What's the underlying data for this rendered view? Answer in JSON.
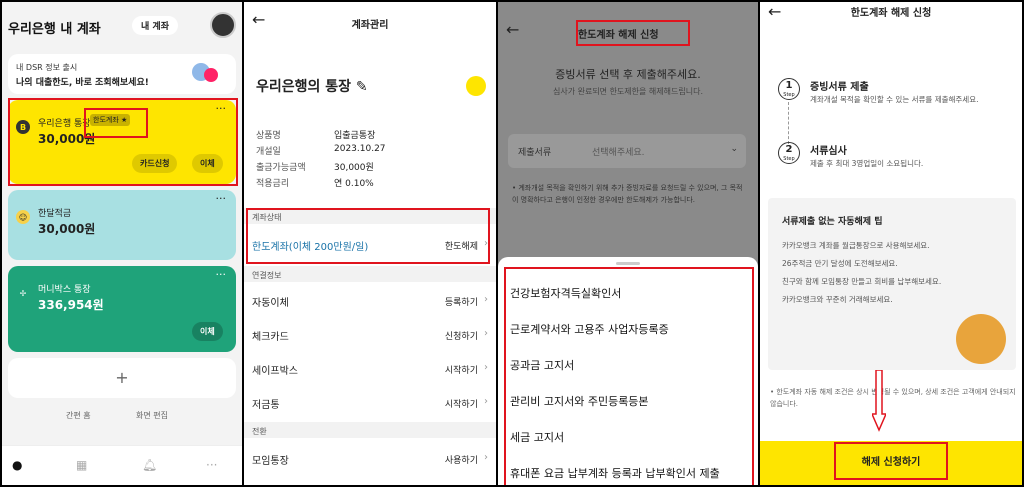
{
  "p1": {
    "title": "우리은행 내 계좌",
    "pill": "내 계좌",
    "banner_line1": "내 DSR 정보 출시",
    "banner_line2": "나의 대출한도, 바로 조회해보세요!",
    "card1": {
      "icon": "B",
      "name": "우리은행 통장",
      "badge": "한도계좌 ★",
      "amount": "30,000원",
      "btn1": "카드신청",
      "btn2": "이체"
    },
    "card2": {
      "name": "한달적금",
      "amount": "30,000원"
    },
    "card3": {
      "name": "머니박스 통장",
      "amount": "336,954원",
      "btn": "이체"
    },
    "plus": "+",
    "link1": "간편 홈",
    "link2": "화면 편집",
    "tabs": [
      "home-icon",
      "grid-icon",
      "bell-icon",
      "more-icon"
    ]
  },
  "p2": {
    "title": "계좌관리",
    "account_name": "우리은행의 통장 ✎",
    "rows": [
      {
        "k": "상품명",
        "v": "입출금통장"
      },
      {
        "k": "개설일",
        "v": "2023.10.27"
      },
      {
        "k": "출금가능금액",
        "v": "30,000원"
      },
      {
        "k": "적용금리",
        "v": "연 0.10%"
      }
    ],
    "status_header": "계좌상태",
    "status_label": "한도계좌(이체 200만원/일)",
    "status_action": "한도해제",
    "link_header": "연결정보",
    "links": [
      {
        "l": "자동이체",
        "r": "등록하기"
      },
      {
        "l": "체크카드",
        "r": "신청하기"
      },
      {
        "l": "세이프박스",
        "r": "시작하기"
      },
      {
        "l": "저금통",
        "r": "시작하기"
      }
    ],
    "switch_header": "전환",
    "moim": "모임통장",
    "moim_action": "사용하기"
  },
  "p3": {
    "title": "한도계좌 해제 신청",
    "subtitle": "증빙서류 선택 후 제출해주세요.",
    "subtitle2": "심사가 완료되면 한도제한을 해제해드립니다.",
    "select_label": "제출서류",
    "select_placeholder": "선택해주세요.",
    "note": "• 계좌개설 목적을 확인하기 위해 추가 증빙자료를 요청드릴 수 있으며, 그 목적이 명확하다고 은행이 인정한 경우에만 한도해제가 가능합니다.",
    "items": [
      "건강보험자격득실확인서",
      "근로계약서와 고용주 사업자등록증",
      "공과금 고지서",
      "관리비 고지서와 주민등록등본",
      "세금 고지서",
      "휴대폰 요금 납부계좌 등록과 납부확인서 제출"
    ]
  },
  "p4": {
    "title": "한도계좌 해제 신청",
    "step1_num": "1",
    "step1_label": "Step",
    "step1_title": "증빙서류 제출",
    "step1_desc": "계좌개설 목적을 확인할 수 있는 서류를 제출해주세요.",
    "step2_num": "2",
    "step2_label": "Step",
    "step2_title": "서류심사",
    "step2_desc": "제출 후 최대 3영업일이 소요됩니다.",
    "tip_title": "서류제출 없는 자동해제 팁",
    "tips": [
      "카카오뱅크 계좌를 월급통장으로 사용해보세요.",
      "26주적금 만기 달성에 도전해보세요.",
      "친구와 함께 모임통장 만들고 회비를 납부해보세요.",
      "카카오뱅크와 꾸준히 거래해보세요."
    ],
    "note": "• 한도계좌 자동 해제 조건은 상시 변경될 수 있으며, 상세 조건은 고객에게 안내되지 않습니다.",
    "apply": "해제 신청하기"
  }
}
